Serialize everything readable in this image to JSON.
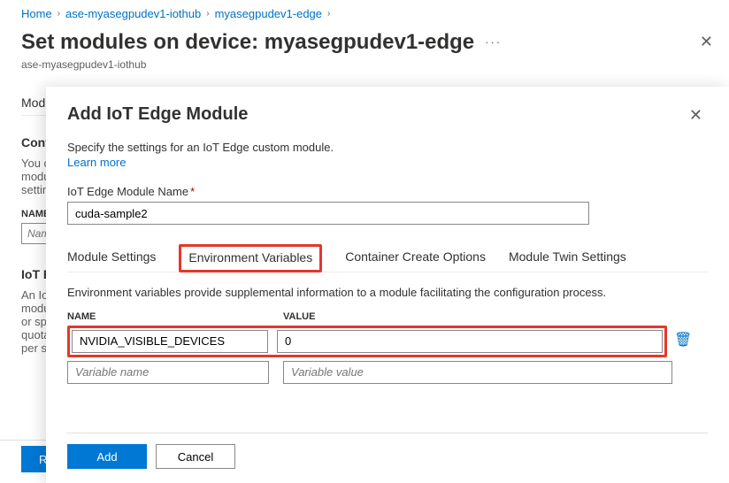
{
  "breadcrumb": {
    "items": [
      {
        "label": "Home"
      },
      {
        "label": "ase-myasegpudev1-iothub"
      },
      {
        "label": "myasegpudev1-edge"
      }
    ]
  },
  "page": {
    "title": "Set modules on device: myasegpudev1-edge",
    "subtitle": "ase-myasegpudev1-iothub"
  },
  "bg": {
    "tab": "Mod",
    "section": "Cont",
    "para1": "You ca",
    "para2": "modul",
    "para3": "settin",
    "name_label": "NAME",
    "name_placeholder": "Nam",
    "section2": "IoT E",
    "p2a": "An IoT",
    "p2b": "modul",
    "p2c": "or spe",
    "p2d": "quota",
    "p2e": "per se",
    "review_btn": "R"
  },
  "panel": {
    "title": "Add IoT Edge Module",
    "desc": "Specify the settings for an IoT Edge custom module.",
    "learn": "Learn more",
    "name_field_label": "IoT Edge Module Name",
    "name_value": "cuda-sample2",
    "tabs": {
      "settings": "Module Settings",
      "env": "Environment Variables",
      "create": "Container Create Options",
      "twin": "Module Twin Settings"
    },
    "env_desc": "Environment variables provide supplemental information to a module facilitating the configuration process.",
    "columns": {
      "name": "NAME",
      "value": "VALUE"
    },
    "rows": [
      {
        "name": "NVIDIA_VISIBLE_DEVICES",
        "value": "0"
      }
    ],
    "placeholder": {
      "name": "Variable name",
      "value": "Variable value"
    },
    "buttons": {
      "add": "Add",
      "cancel": "Cancel"
    }
  }
}
